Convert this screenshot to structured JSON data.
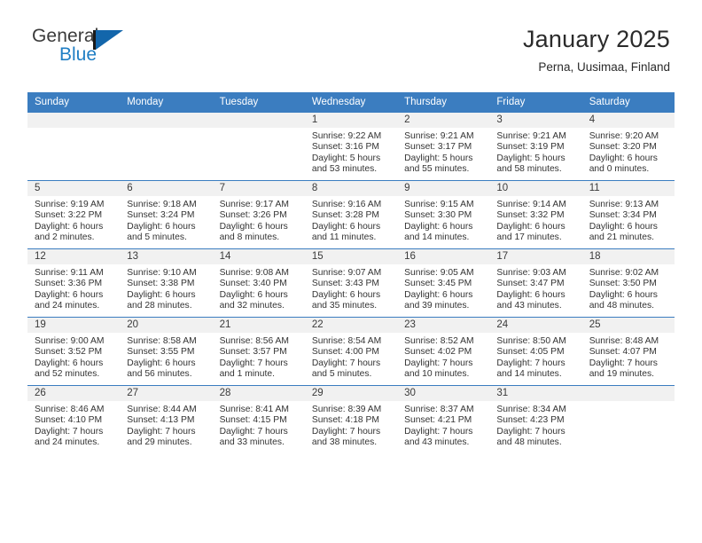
{
  "brand": {
    "name_part1": "General",
    "name_part2": "Blue",
    "logo_icon": "triangle-flag-icon",
    "accent_color": "#1366ab"
  },
  "header": {
    "title": "January 2025",
    "subtitle": "Perna, Uusimaa, Finland"
  },
  "calendar": {
    "header_color": "#3b7dc0",
    "day_band_color": "#f1f1f1",
    "weekday_headers": [
      "Sunday",
      "Monday",
      "Tuesday",
      "Wednesday",
      "Thursday",
      "Friday",
      "Saturday"
    ],
    "weeks": [
      [
        {
          "day": "",
          "sunrise": "",
          "sunset": "",
          "daylight": "",
          "daylight2": ""
        },
        {
          "day": "",
          "sunrise": "",
          "sunset": "",
          "daylight": "",
          "daylight2": ""
        },
        {
          "day": "",
          "sunrise": "",
          "sunset": "",
          "daylight": "",
          "daylight2": ""
        },
        {
          "day": "1",
          "sunrise": "Sunrise: 9:22 AM",
          "sunset": "Sunset: 3:16 PM",
          "daylight": "Daylight: 5 hours",
          "daylight2": "and 53 minutes."
        },
        {
          "day": "2",
          "sunrise": "Sunrise: 9:21 AM",
          "sunset": "Sunset: 3:17 PM",
          "daylight": "Daylight: 5 hours",
          "daylight2": "and 55 minutes."
        },
        {
          "day": "3",
          "sunrise": "Sunrise: 9:21 AM",
          "sunset": "Sunset: 3:19 PM",
          "daylight": "Daylight: 5 hours",
          "daylight2": "and 58 minutes."
        },
        {
          "day": "4",
          "sunrise": "Sunrise: 9:20 AM",
          "sunset": "Sunset: 3:20 PM",
          "daylight": "Daylight: 6 hours",
          "daylight2": "and 0 minutes."
        }
      ],
      [
        {
          "day": "5",
          "sunrise": "Sunrise: 9:19 AM",
          "sunset": "Sunset: 3:22 PM",
          "daylight": "Daylight: 6 hours",
          "daylight2": "and 2 minutes."
        },
        {
          "day": "6",
          "sunrise": "Sunrise: 9:18 AM",
          "sunset": "Sunset: 3:24 PM",
          "daylight": "Daylight: 6 hours",
          "daylight2": "and 5 minutes."
        },
        {
          "day": "7",
          "sunrise": "Sunrise: 9:17 AM",
          "sunset": "Sunset: 3:26 PM",
          "daylight": "Daylight: 6 hours",
          "daylight2": "and 8 minutes."
        },
        {
          "day": "8",
          "sunrise": "Sunrise: 9:16 AM",
          "sunset": "Sunset: 3:28 PM",
          "daylight": "Daylight: 6 hours",
          "daylight2": "and 11 minutes."
        },
        {
          "day": "9",
          "sunrise": "Sunrise: 9:15 AM",
          "sunset": "Sunset: 3:30 PM",
          "daylight": "Daylight: 6 hours",
          "daylight2": "and 14 minutes."
        },
        {
          "day": "10",
          "sunrise": "Sunrise: 9:14 AM",
          "sunset": "Sunset: 3:32 PM",
          "daylight": "Daylight: 6 hours",
          "daylight2": "and 17 minutes."
        },
        {
          "day": "11",
          "sunrise": "Sunrise: 9:13 AM",
          "sunset": "Sunset: 3:34 PM",
          "daylight": "Daylight: 6 hours",
          "daylight2": "and 21 minutes."
        }
      ],
      [
        {
          "day": "12",
          "sunrise": "Sunrise: 9:11 AM",
          "sunset": "Sunset: 3:36 PM",
          "daylight": "Daylight: 6 hours",
          "daylight2": "and 24 minutes."
        },
        {
          "day": "13",
          "sunrise": "Sunrise: 9:10 AM",
          "sunset": "Sunset: 3:38 PM",
          "daylight": "Daylight: 6 hours",
          "daylight2": "and 28 minutes."
        },
        {
          "day": "14",
          "sunrise": "Sunrise: 9:08 AM",
          "sunset": "Sunset: 3:40 PM",
          "daylight": "Daylight: 6 hours",
          "daylight2": "and 32 minutes."
        },
        {
          "day": "15",
          "sunrise": "Sunrise: 9:07 AM",
          "sunset": "Sunset: 3:43 PM",
          "daylight": "Daylight: 6 hours",
          "daylight2": "and 35 minutes."
        },
        {
          "day": "16",
          "sunrise": "Sunrise: 9:05 AM",
          "sunset": "Sunset: 3:45 PM",
          "daylight": "Daylight: 6 hours",
          "daylight2": "and 39 minutes."
        },
        {
          "day": "17",
          "sunrise": "Sunrise: 9:03 AM",
          "sunset": "Sunset: 3:47 PM",
          "daylight": "Daylight: 6 hours",
          "daylight2": "and 43 minutes."
        },
        {
          "day": "18",
          "sunrise": "Sunrise: 9:02 AM",
          "sunset": "Sunset: 3:50 PM",
          "daylight": "Daylight: 6 hours",
          "daylight2": "and 48 minutes."
        }
      ],
      [
        {
          "day": "19",
          "sunrise": "Sunrise: 9:00 AM",
          "sunset": "Sunset: 3:52 PM",
          "daylight": "Daylight: 6 hours",
          "daylight2": "and 52 minutes."
        },
        {
          "day": "20",
          "sunrise": "Sunrise: 8:58 AM",
          "sunset": "Sunset: 3:55 PM",
          "daylight": "Daylight: 6 hours",
          "daylight2": "and 56 minutes."
        },
        {
          "day": "21",
          "sunrise": "Sunrise: 8:56 AM",
          "sunset": "Sunset: 3:57 PM",
          "daylight": "Daylight: 7 hours",
          "daylight2": "and 1 minute."
        },
        {
          "day": "22",
          "sunrise": "Sunrise: 8:54 AM",
          "sunset": "Sunset: 4:00 PM",
          "daylight": "Daylight: 7 hours",
          "daylight2": "and 5 minutes."
        },
        {
          "day": "23",
          "sunrise": "Sunrise: 8:52 AM",
          "sunset": "Sunset: 4:02 PM",
          "daylight": "Daylight: 7 hours",
          "daylight2": "and 10 minutes."
        },
        {
          "day": "24",
          "sunrise": "Sunrise: 8:50 AM",
          "sunset": "Sunset: 4:05 PM",
          "daylight": "Daylight: 7 hours",
          "daylight2": "and 14 minutes."
        },
        {
          "day": "25",
          "sunrise": "Sunrise: 8:48 AM",
          "sunset": "Sunset: 4:07 PM",
          "daylight": "Daylight: 7 hours",
          "daylight2": "and 19 minutes."
        }
      ],
      [
        {
          "day": "26",
          "sunrise": "Sunrise: 8:46 AM",
          "sunset": "Sunset: 4:10 PM",
          "daylight": "Daylight: 7 hours",
          "daylight2": "and 24 minutes."
        },
        {
          "day": "27",
          "sunrise": "Sunrise: 8:44 AM",
          "sunset": "Sunset: 4:13 PM",
          "daylight": "Daylight: 7 hours",
          "daylight2": "and 29 minutes."
        },
        {
          "day": "28",
          "sunrise": "Sunrise: 8:41 AM",
          "sunset": "Sunset: 4:15 PM",
          "daylight": "Daylight: 7 hours",
          "daylight2": "and 33 minutes."
        },
        {
          "day": "29",
          "sunrise": "Sunrise: 8:39 AM",
          "sunset": "Sunset: 4:18 PM",
          "daylight": "Daylight: 7 hours",
          "daylight2": "and 38 minutes."
        },
        {
          "day": "30",
          "sunrise": "Sunrise: 8:37 AM",
          "sunset": "Sunset: 4:21 PM",
          "daylight": "Daylight: 7 hours",
          "daylight2": "and 43 minutes."
        },
        {
          "day": "31",
          "sunrise": "Sunrise: 8:34 AM",
          "sunset": "Sunset: 4:23 PM",
          "daylight": "Daylight: 7 hours",
          "daylight2": "and 48 minutes."
        },
        {
          "day": "",
          "sunrise": "",
          "sunset": "",
          "daylight": "",
          "daylight2": ""
        }
      ]
    ]
  }
}
